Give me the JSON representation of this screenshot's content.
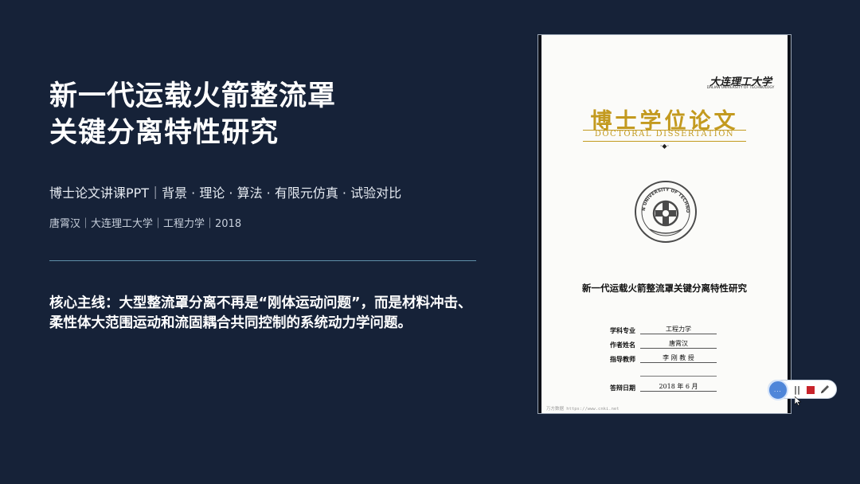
{
  "slide": {
    "title_line1": "新一代运载火箭整流罩",
    "title_line2": "关键分离特性研究",
    "subtitle": "博士论文讲课PPT｜背景 · 理论 · 算法 · 有限元仿真 · 试验对比",
    "author_line": "唐霄汉｜大连理工大学｜工程力学｜2018",
    "core_message": "核心主线：大型整流罩分离不再是“刚体运动问题”，而是材料冲击、柔性体大范围运动和流固耦合共同控制的系统动力学问题。"
  },
  "cover": {
    "university_cn": "大连理工大学",
    "university_en": "DALIAN UNIVERSITY OF TECHNOLOGY",
    "degree_cn": "博士学位论文",
    "degree_en": "DOCTORAL DISSERTATION",
    "seal_text": "DALIAN UNIVERSITY OF TECHNOLOGY",
    "thesis_title": "新一代运载火箭整流罩关键分离特性研究",
    "rows": [
      {
        "label": "学科专业",
        "value": "工程力学"
      },
      {
        "label": "作者姓名",
        "value": "唐霄汉"
      },
      {
        "label": "指导教师",
        "value": "李  刚  教  授"
      },
      {
        "label": "答辩日期",
        "value": "2018 年 6 月"
      }
    ],
    "footer": "万方数据     https://www.cnki.net"
  },
  "toolbar": {
    "pause_label": "||"
  },
  "colors": {
    "background": "#162238",
    "gold": "#c39a1f",
    "record_red": "#c8232b",
    "divider": "#5f8fa8"
  }
}
